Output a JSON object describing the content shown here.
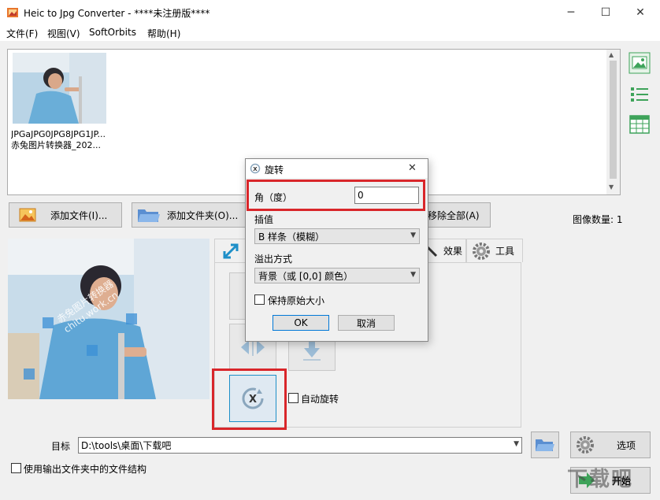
{
  "window": {
    "title": "Heic to Jpg Converter - ****未注册版****",
    "minimize": "─",
    "maximize": "☐",
    "close": "✕"
  },
  "menu": {
    "items": [
      {
        "label": "文件(F)"
      },
      {
        "label": "视图(V)"
      },
      {
        "label": "SoftOrbits"
      },
      {
        "label": "帮助(H)"
      }
    ]
  },
  "file_list": {
    "items": [
      {
        "line1": "JPGaJPG0JPG8JPG1JP...",
        "line2": "赤兔图片转换器_202..."
      }
    ]
  },
  "actions": {
    "add_file": "添加文件(I)...",
    "add_folder": "添加文件夹(O)...",
    "remove_all": "移除全部(A)",
    "image_count": "图像数量: 1"
  },
  "tabs": {
    "effects": "效果",
    "tools": "工具"
  },
  "rotate_panel": {
    "auto_rotate": "自动旋转"
  },
  "output": {
    "target_label": "目标",
    "target_path": "D:\\tools\\桌面\\下载吧",
    "options": "选项",
    "start": "开始",
    "keep_structure": "使用输出文件夹中的文件结构"
  },
  "preview": {
    "watermark_line1": "赤兔图片转换器",
    "watermark_line2": "chitu.work.cn"
  },
  "dialog": {
    "title": "旋转",
    "close": "✕",
    "angle_label": "角（度）",
    "angle_value": "0",
    "interp_label": "插值",
    "interp_value": "B 样条（模糊）",
    "overflow_label": "溢出方式",
    "overflow_value": "背景（或 [0,0] 颜色）",
    "keep_size": "保持原始大小",
    "ok": "OK",
    "cancel": "取消"
  },
  "brand_watermark": "下载吧",
  "colors": {
    "highlight": "#d9262a",
    "accent_teal": "#1e8fc8",
    "view_icon_green": "#3ea35a"
  }
}
